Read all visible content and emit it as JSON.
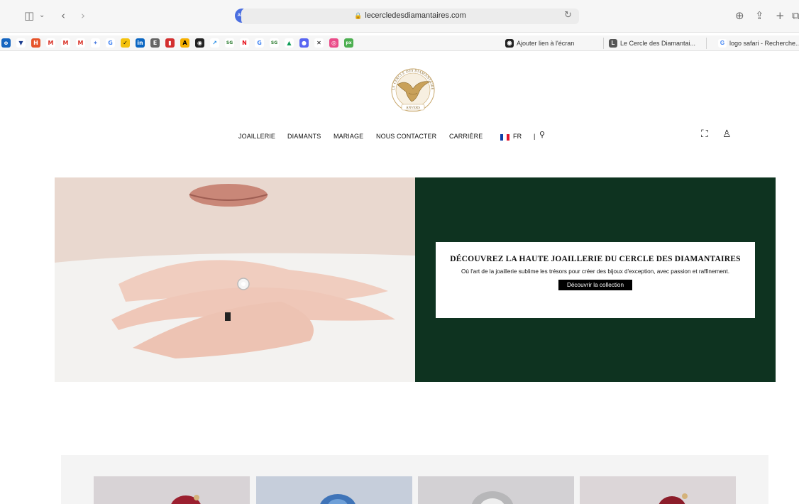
{
  "browser": {
    "url": "lecercledesdiamantaires.com",
    "abp_label": "ABP",
    "tabs": [
      {
        "label": "Ajouter lien à l'écran"
      },
      {
        "label": "Le Cercle des Diamantai..."
      },
      {
        "label": "logo safari - Recherche..."
      }
    ],
    "bookmark_icons": [
      "outlook-icon",
      "scholar-icon",
      "h-icon",
      "gmail-icon",
      "gmail-icon",
      "gmail-icon",
      "gemini-icon",
      "google-icon",
      "norton-icon",
      "linkedin-icon",
      "e-icon",
      "bookmark-icon",
      "a-icon",
      "openai-icon",
      "assistant-icon",
      "sg-icon",
      "netflix-icon",
      "google-icon",
      "sg-icon",
      "drive-icon",
      "app-icon",
      "x-icon",
      "dribbble-icon",
      "px-icon"
    ]
  },
  "site": {
    "logo_text_top": "LE CERCLE DES DIAMANTAIRES",
    "logo_text_bottom": "ANVERS",
    "nav": {
      "jewelry": "JOAILLERIE",
      "diamonds": "DIAMANTS",
      "wedding": "MARIAGE",
      "contact": "NOUS CONTACTER",
      "careers": "CARRIÈRE",
      "language": "FR",
      "separator": "|"
    },
    "flag_colors": [
      "#0b3fa8",
      "#ffffff",
      "#e0142b"
    ]
  },
  "hero": {
    "title": "DÉCOUVREZ LA HAUTE JOAILLERIE DU CERCLE DES DIAMANTAIRES",
    "subtitle": "Où l'art de la joaillerie sublime les trésors pour créer des bijoux d'exception, avec passion et raffinement.",
    "button": "Découvrir la collection",
    "panel_color": "#0e3320"
  }
}
